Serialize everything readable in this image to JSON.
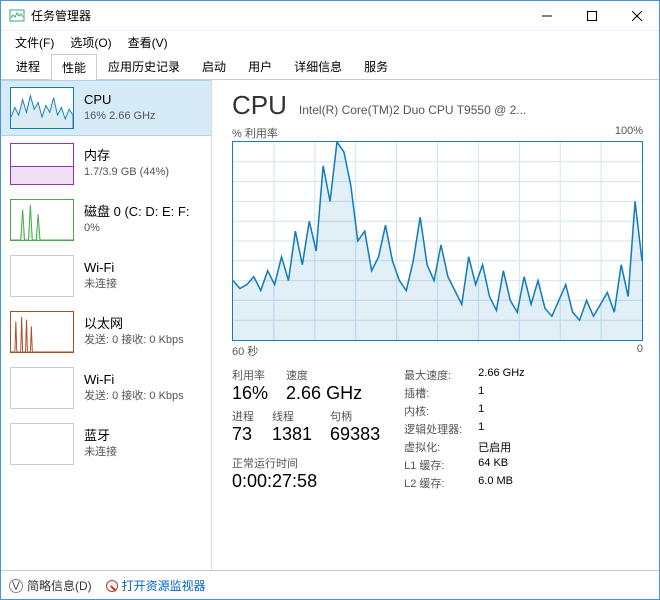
{
  "window": {
    "title": "任务管理器"
  },
  "menu": {
    "file": "文件(F)",
    "options": "选项(O)",
    "view": "查看(V)"
  },
  "tabs": [
    "进程",
    "性能",
    "应用历史记录",
    "启动",
    "用户",
    "详细信息",
    "服务"
  ],
  "active_tab": 1,
  "sidebar": [
    {
      "title": "CPU",
      "sub": "16% 2.66 GHz",
      "kind": "cpu"
    },
    {
      "title": "内存",
      "sub": "1.7/3.9 GB (44%)",
      "kind": "mem"
    },
    {
      "title": "磁盘 0 (C: D: E: F:",
      "sub": "0%",
      "kind": "disk"
    },
    {
      "title": "Wi-Fi",
      "sub": "未连接",
      "kind": "wifi"
    },
    {
      "title": "以太网",
      "sub": "发送: 0 接收: 0 Kbps",
      "kind": "eth"
    },
    {
      "title": "Wi-Fi",
      "sub": "发送: 0 接收: 0 Kbps",
      "kind": "wifi"
    },
    {
      "title": "蓝牙",
      "sub": "未连接",
      "kind": "bt"
    }
  ],
  "detail": {
    "heading": "CPU",
    "desc": "Intel(R) Core(TM)2 Duo CPU T9550 @ 2...",
    "chart_top_left": "% 利用率",
    "chart_top_right": "100%",
    "chart_bot_left": "60 秒",
    "chart_bot_right": "0",
    "util_lbl": "利用率",
    "util_val": "16%",
    "speed_lbl": "速度",
    "speed_val": "2.66 GHz",
    "proc_lbl": "进程",
    "proc_val": "73",
    "thread_lbl": "线程",
    "thread_val": "1381",
    "handle_lbl": "句柄",
    "handle_val": "69383",
    "uptime_lbl": "正常运行时间",
    "uptime_val": "0:00:27:58",
    "right": {
      "maxspeed_k": "最大速度:",
      "maxspeed_v": "2.66 GHz",
      "sockets_k": "插槽:",
      "sockets_v": "1",
      "cores_k": "内核:",
      "cores_v": "1",
      "lproc_k": "逻辑处理器:",
      "lproc_v": "1",
      "virt_k": "虚拟化:",
      "virt_v": "已启用",
      "l1_k": "L1 缓存:",
      "l1_v": "64 KB",
      "l2_k": "L2 缓存:",
      "l2_v": "6.0 MB"
    }
  },
  "footer": {
    "fewer": "简略信息(D)",
    "resmon": "打开资源监视器"
  },
  "chart_data": {
    "type": "line",
    "title": "% 利用率",
    "xlabel": "60 秒",
    "ylabel": "",
    "xlim": [
      0,
      60
    ],
    "ylim": [
      0,
      100
    ],
    "x": [
      0,
      1,
      2,
      3,
      4,
      5,
      6,
      7,
      8,
      9,
      10,
      11,
      12,
      13,
      14,
      15,
      16,
      17,
      18,
      19,
      20,
      21,
      22,
      23,
      24,
      25,
      26,
      27,
      28,
      29,
      30,
      31,
      32,
      33,
      34,
      35,
      36,
      37,
      38,
      39,
      40,
      41,
      42,
      43,
      44,
      45,
      46,
      47,
      48,
      49,
      50,
      51,
      52,
      53,
      54,
      55,
      56,
      57,
      58,
      59
    ],
    "values": [
      30,
      26,
      28,
      32,
      25,
      35,
      28,
      42,
      30,
      55,
      38,
      60,
      45,
      88,
      70,
      100,
      95,
      78,
      50,
      55,
      35,
      42,
      58,
      40,
      30,
      25,
      40,
      62,
      38,
      30,
      48,
      32,
      25,
      18,
      42,
      28,
      38,
      22,
      15,
      35,
      20,
      14,
      32,
      18,
      30,
      16,
      12,
      20,
      28,
      14,
      10,
      20,
      12,
      18,
      24,
      14,
      38,
      22,
      70,
      40
    ]
  }
}
